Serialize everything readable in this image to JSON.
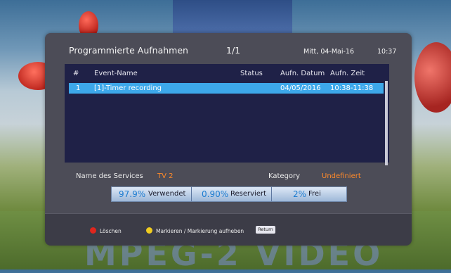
{
  "header": {
    "title": "Programmierte Aufnahmen",
    "page": "1/1",
    "date": "Mitt, 04-Mai-16",
    "time": "10:37"
  },
  "table": {
    "columns": [
      "#",
      "Event-Name",
      "Status",
      "Aufn. Datum",
      "Aufn. Zeit"
    ],
    "rows": [
      {
        "num": "1",
        "event": "[1]-Timer recording",
        "status": "",
        "date": "04/05/2016",
        "time": "10:38-11:38"
      }
    ]
  },
  "info": {
    "service_label": "Name des Services",
    "service_value": "TV 2",
    "category_label": "Kategory",
    "category_value": "Undefiniert"
  },
  "usage": {
    "used_pct": "97.9%",
    "used_label": "Verwendet",
    "reserved_pct": "0.90%",
    "reserved_label": "Reserviert",
    "free_pct": "2%",
    "free_label": "Frei"
  },
  "footer": {
    "red_label": "Löschen",
    "yellow_label": "Markieren / Markierung aufheben",
    "return_key": "Return",
    "red_color": "#e0261e",
    "yellow_color": "#f0cc20"
  },
  "background": {
    "watermark": "MPEG-2 VIDEO"
  }
}
